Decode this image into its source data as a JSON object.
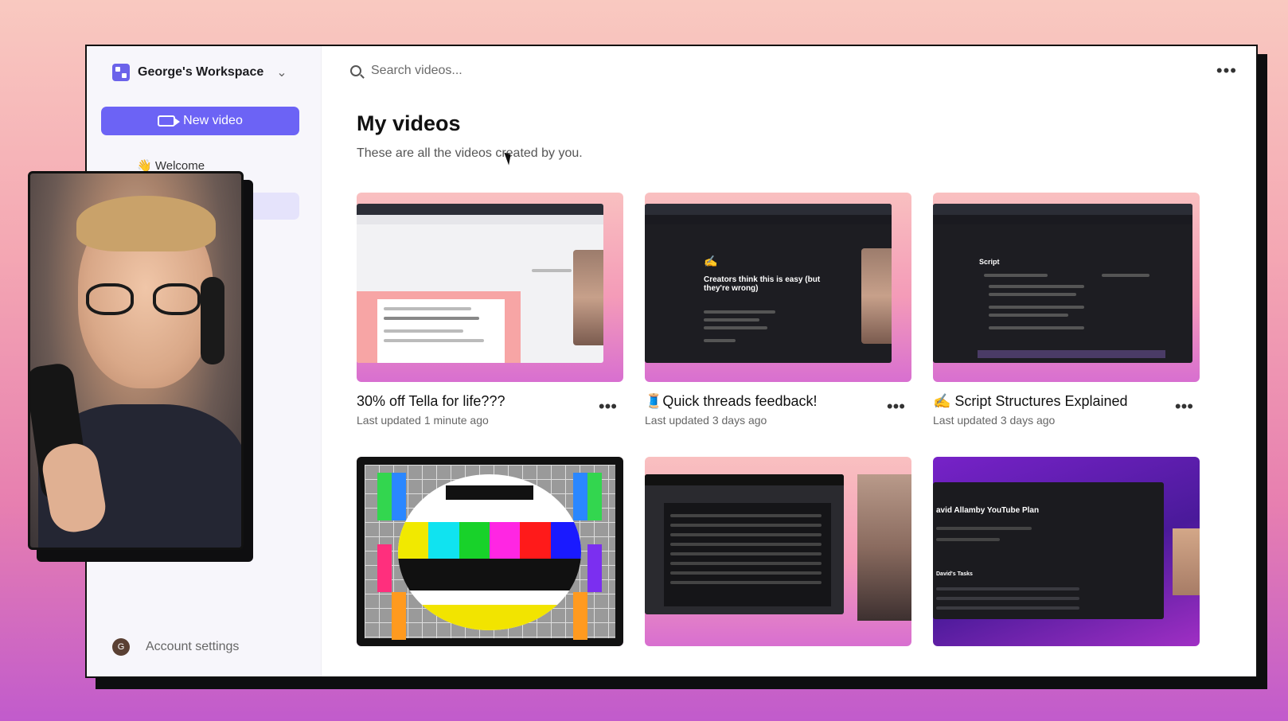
{
  "sidebar": {
    "workspace_name": "George's Workspace",
    "new_video_label": "New video",
    "nav": [
      {
        "label": "Welcome",
        "icon": "wave-emoji"
      }
    ],
    "account_avatar_initial": "G",
    "account_label": "Account settings"
  },
  "search": {
    "placeholder": "Search videos..."
  },
  "page": {
    "title": "My videos",
    "subtitle": "These are all the videos created by you."
  },
  "videos": [
    {
      "title": "30% off Tella for life???",
      "meta": "Last updated 1 minute ago",
      "thumb_style": "light-doc"
    },
    {
      "title": "🧵Quick threads feedback!",
      "meta": "Last updated 3 days ago",
      "thumb_style": "dark-doc",
      "thumb_text": "Creators think this is easy (but they're wrong)"
    },
    {
      "title": "✍️ Script Structures Explained",
      "meta": "Last updated 3 days ago",
      "thumb_style": "dark-doc",
      "thumb_text": "Script"
    },
    {
      "title": "",
      "meta": "",
      "thumb_style": "test-card"
    },
    {
      "title": "",
      "meta": "",
      "thumb_style": "activity"
    },
    {
      "title": "",
      "meta": "",
      "thumb_style": "purple-plan",
      "thumb_text": "avid Allamby YouTube Plan",
      "thumb_sub": "David's Tasks"
    }
  ],
  "colors": {
    "accent": "#6c63f5",
    "background_top": "#f9c9c0",
    "background_bottom": "#c15bcc"
  }
}
